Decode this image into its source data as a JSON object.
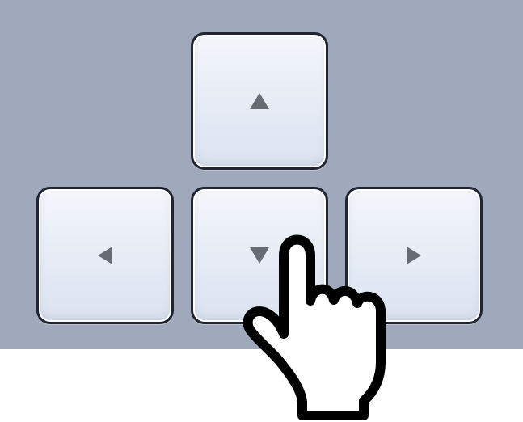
{
  "panel": {
    "background": "#9fa9bb"
  },
  "keys": {
    "up": {
      "icon": "up-triangle-icon",
      "glyph": "▲"
    },
    "left": {
      "icon": "left-triangle-icon",
      "glyph": "◀"
    },
    "down": {
      "icon": "down-triangle-icon",
      "glyph": "▼"
    },
    "right": {
      "icon": "right-triangle-icon",
      "glyph": "▶"
    }
  },
  "cursor": {
    "icon": "pointing-hand-icon",
    "pressed_key": "down"
  },
  "colors": {
    "key_face_top": "#f3f6fb",
    "key_face_bottom": "#dbe3f0",
    "key_border": "#1f2430",
    "arrow": "#676b73",
    "hand_fill": "#ffffff",
    "hand_outline": "#000000",
    "page_background": "#ffffff"
  }
}
